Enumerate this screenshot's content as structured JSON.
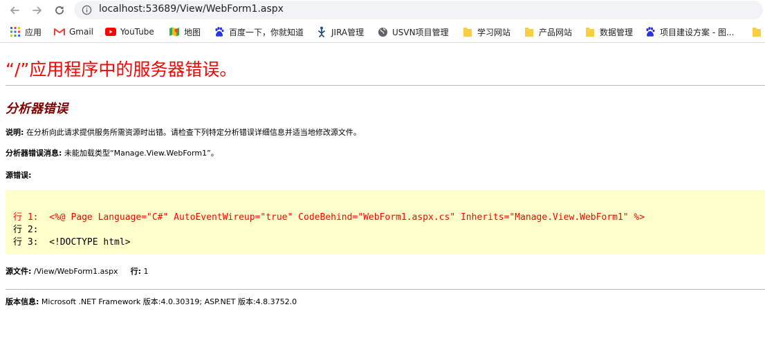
{
  "browser": {
    "url": "localhost:53689/View/WebForm1.aspx",
    "bookmarks": [
      {
        "label": "应用",
        "icon": "apps-grid-icon"
      },
      {
        "label": "Gmail",
        "icon": "gmail-icon"
      },
      {
        "label": "YouTube",
        "icon": "youtube-icon"
      },
      {
        "label": "地图",
        "icon": "maps-icon"
      },
      {
        "label": "百度一下，你就知道",
        "icon": "baidu-paw-icon"
      },
      {
        "label": "JIRA管理",
        "icon": "jira-icon"
      },
      {
        "label": "USVN项目管理",
        "icon": "globe-icon"
      },
      {
        "label": "学习网站",
        "icon": "folder-icon"
      },
      {
        "label": "产品网站",
        "icon": "folder-icon"
      },
      {
        "label": "数据管理",
        "icon": "folder-icon"
      },
      {
        "label": "项目建设方案 - 图...",
        "icon": "baidu-paw-icon"
      }
    ]
  },
  "page": {
    "title": "“/”应用程序中的服务器错误。",
    "subtitle": "分析器错误",
    "description_label": "说明:",
    "description_text": " 在分析向此请求提供服务所需资源时出错。请检查下列特定分析错误详细信息并适当地修改源文件。",
    "parser_label": "分析器错误消息:",
    "parser_text": " 未能加载类型“Manage.View.WebForm1”。",
    "source_error_label": "源错误:",
    "code_lines": [
      {
        "prefix": "行 1:  ",
        "text": "<%@ Page Language=\"C#\" AutoEventWireup=\"true\" CodeBehind=\"WebForm1.aspx.cs\" Inherits=\"Manage.View.WebForm1\" %>"
      },
      {
        "prefix": "行 2:  ",
        "text": ""
      },
      {
        "prefix": "行 3:  ",
        "text": "<!DOCTYPE html>"
      }
    ],
    "source_file_label": "源文件:",
    "source_file_value": " /View/WebForm1.aspx",
    "line_label": "行:",
    "line_value": " 1",
    "version_label": "版本信息:",
    "version_text": " Microsoft .NET Framework 版本:4.0.30319; ASP.NET 版本:4.8.3752.0"
  },
  "colors": {
    "title": "#ff0000",
    "subtitle": "#800000",
    "code_background": "#ffffcc",
    "code_highlight": "#ff0000"
  }
}
